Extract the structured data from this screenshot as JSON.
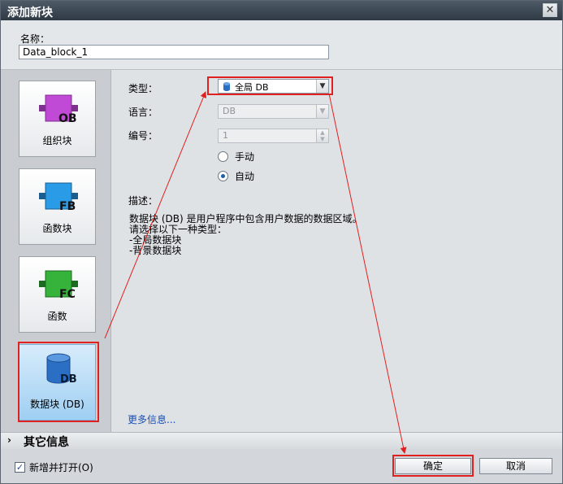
{
  "window": {
    "title": "添加新块",
    "close_glyph": "✕"
  },
  "name": {
    "label": "名称：",
    "value": "Data_block_1"
  },
  "blocks": [
    {
      "id": "ob",
      "label": "组织块",
      "badge": "OB",
      "color": "#b43cc7"
    },
    {
      "id": "fb",
      "label": "函数块",
      "badge": "FB",
      "color": "#1e8fd8"
    },
    {
      "id": "fc",
      "label": "函数",
      "badge": "FC",
      "color": "#2aa12f"
    },
    {
      "id": "db",
      "label": "数据块 (DB)",
      "badge": "DB",
      "color": "#1f6fc5",
      "selected": true
    }
  ],
  "fields": {
    "type_label": "类型：",
    "type_value": "全局 DB",
    "language_label": "语言：",
    "language_value": "DB",
    "number_label": "编号：",
    "number_value": "1",
    "radio_manual": "手动",
    "radio_auto": "自动",
    "radio_selected": "auto"
  },
  "description": {
    "label": "描述：",
    "text": "数据块 (DB) 是用户程序中包含用户数据的数据区域。\n请选择以下一种类型：\n-全局数据块\n-背景数据块"
  },
  "more_info": "更多信息...",
  "other_info": {
    "label": "其它信息",
    "chevron": "›"
  },
  "footer": {
    "add_open_label": "新增并打开(O)",
    "add_open_checked": true,
    "ok_label": "确定",
    "cancel_label": "取消"
  },
  "highlight_color": "#e12020"
}
